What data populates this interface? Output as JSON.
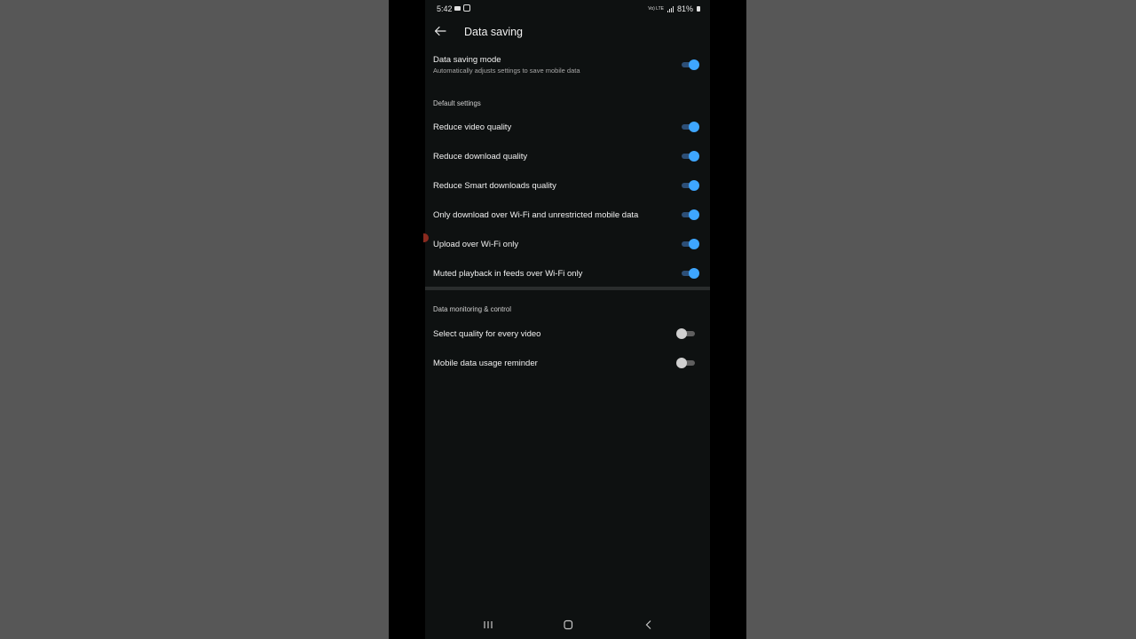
{
  "status_bar": {
    "time": "5:42",
    "network_label": "Vo) LTE",
    "battery": "81%"
  },
  "app_bar": {
    "back_icon": "arrow-left-icon",
    "title": "Data saving"
  },
  "data_saving_mode": {
    "label": "Data saving mode",
    "description": "Automatically adjusts settings to save mobile data",
    "enabled": true
  },
  "default_settings": {
    "header": "Default settings",
    "items": [
      {
        "label": "Reduce video quality",
        "enabled": true
      },
      {
        "label": "Reduce download quality",
        "enabled": true
      },
      {
        "label": "Reduce Smart downloads quality",
        "enabled": true
      },
      {
        "label": "Only download over Wi-Fi and unrestricted mobile data",
        "enabled": true
      },
      {
        "label": "Upload over Wi-Fi only",
        "enabled": true
      },
      {
        "label": "Muted playback in feeds over Wi-Fi only",
        "enabled": true
      }
    ]
  },
  "data_monitoring": {
    "header": "Data monitoring & control",
    "items": [
      {
        "label": "Select quality for every video",
        "enabled": false
      },
      {
        "label": "Mobile data usage reminder",
        "enabled": false
      }
    ]
  },
  "nav_bar": {
    "icons": [
      "recent-apps-icon",
      "home-icon",
      "back-icon"
    ]
  },
  "colors": {
    "toggle_on_knob": "#3ea6ff",
    "toggle_on_track": "#2d4f77",
    "toggle_off_knob": "#d0d0d0",
    "screen_background": "#0e1111"
  }
}
